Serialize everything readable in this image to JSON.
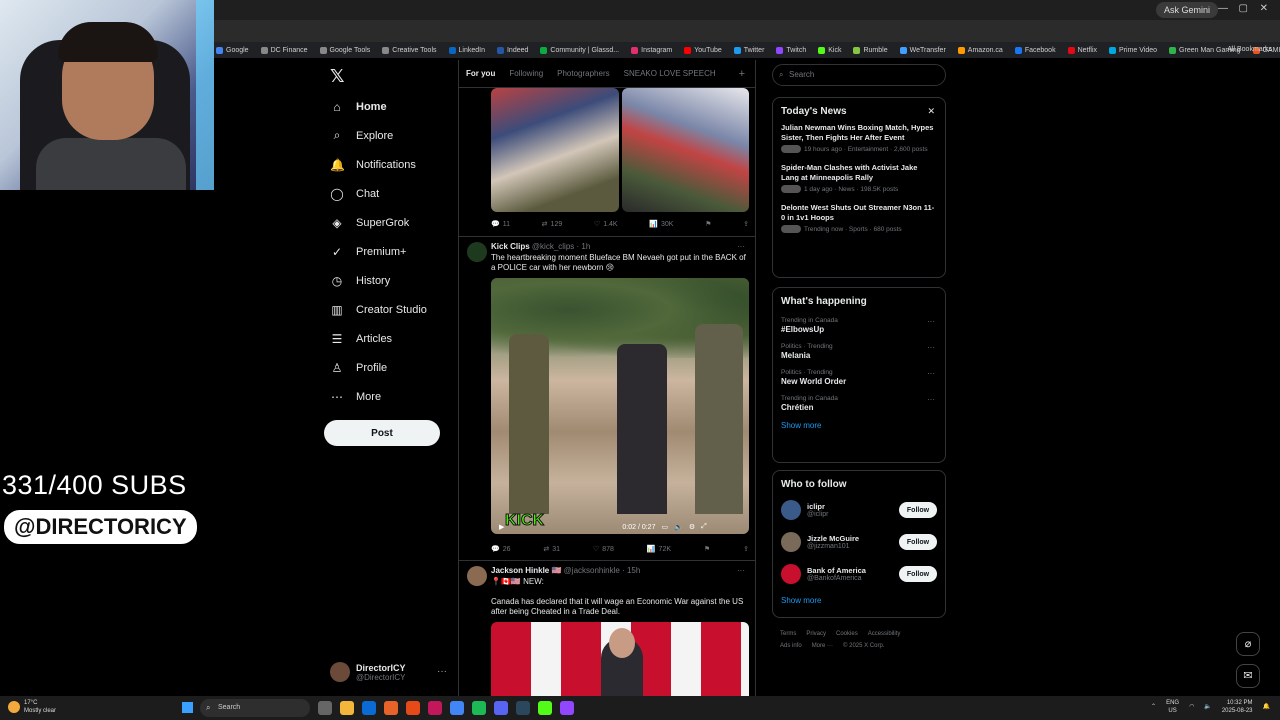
{
  "browser": {
    "gemini_label": "Ask Gemini",
    "bookmarks": [
      {
        "label": "Google",
        "color": "#4285f4"
      },
      {
        "label": "DC Finance",
        "color": "#888888"
      },
      {
        "label": "Google Tools",
        "color": "#888888"
      },
      {
        "label": "Creative Tools",
        "color": "#888888"
      },
      {
        "label": "LinkedIn",
        "color": "#0a66c2"
      },
      {
        "label": "Indeed",
        "color": "#2557a7"
      },
      {
        "label": "Community | Glassd...",
        "color": "#0caa41"
      },
      {
        "label": "Instagram",
        "color": "#e1306c"
      },
      {
        "label": "YouTube",
        "color": "#ff0000"
      },
      {
        "label": "Twitter",
        "color": "#1d9bf0"
      },
      {
        "label": "Twitch",
        "color": "#9146ff"
      },
      {
        "label": "Kick",
        "color": "#53fc18"
      },
      {
        "label": "Rumble",
        "color": "#85c742"
      },
      {
        "label": "WeTransfer",
        "color": "#409fff"
      },
      {
        "label": "Amazon.ca",
        "color": "#ff9900"
      },
      {
        "label": "Facebook",
        "color": "#1877f2"
      },
      {
        "label": "Netflix",
        "color": "#e50914"
      },
      {
        "label": "Prime Video",
        "color": "#00a8e1"
      },
      {
        "label": "Green Man Gaming",
        "color": "#2fb44a"
      },
      {
        "label": "GAMIVO | Video ga...",
        "color": "#e95420"
      }
    ],
    "all_bookmarks": "All Bookmarks"
  },
  "overlay": {
    "subs": "331/400 SUBS",
    "handle": "@DIRECTORICY"
  },
  "nav": {
    "items": [
      {
        "label": "Home",
        "icon": "⌂"
      },
      {
        "label": "Explore",
        "icon": "⌕"
      },
      {
        "label": "Notifications",
        "icon": "🔔"
      },
      {
        "label": "Chat",
        "icon": "◯"
      },
      {
        "label": "SuperGrok",
        "icon": "◈"
      },
      {
        "label": "Premium+",
        "icon": "✓"
      },
      {
        "label": "History",
        "icon": "◷"
      },
      {
        "label": "Creator Studio",
        "icon": "▥"
      },
      {
        "label": "Articles",
        "icon": "☰"
      },
      {
        "label": "Profile",
        "icon": "♙"
      },
      {
        "label": "More",
        "icon": "⋯"
      }
    ],
    "post": "Post",
    "account_name": "DirectorICY",
    "account_handle": "@DirectorICY"
  },
  "feed": {
    "tabs": [
      "For you",
      "Following",
      "Photographers",
      "SNEAKO LOVE SPEECH"
    ],
    "tweet0_actions": {
      "replies": "11",
      "reposts": "129",
      "likes": "1.4K",
      "views": "30K"
    },
    "tweet1": {
      "name": "Kick Clips",
      "handle": "@kick_clips",
      "time": "· 1h",
      "text": "The heartbreaking moment Blueface BM Nevaeh got put in the BACK of a POLICE car with her newborn 😢",
      "video_time": "0:02 / 0:27",
      "watermark": "KICK",
      "actions": {
        "replies": "26",
        "reposts": "31",
        "likes": "878",
        "views": "72K"
      }
    },
    "tweet2": {
      "name": "Jackson Hinkle 🇺🇸",
      "handle": "@jacksonhinkle",
      "time": "· 15h",
      "line1": "📍🇨🇦🇺🇸 NEW:",
      "text": "Canada has declared that it will wage an Economic War against the US after being Cheated in a Trade Deal."
    }
  },
  "sidebar": {
    "search_placeholder": "Search",
    "news_title": "Today's News",
    "news": [
      {
        "headline": "Julian Newman Wins Boxing Match, Hypes Sister, Then Fights Her After Event",
        "meta": "19 hours ago · Entertainment · 2,600 posts"
      },
      {
        "headline": "Spider-Man Clashes with Activist Jake Lang at Minneapolis Rally",
        "meta": "1 day ago · News · 198.5K posts"
      },
      {
        "headline": "Delonte West Shuts Out Streamer N3on 11-0 in 1v1 Hoops",
        "meta": "Trending now · Sports · 680 posts"
      }
    ],
    "happening_title": "What's happening",
    "trends": [
      {
        "context": "Trending in Canada",
        "title": "#ElbowsUp"
      },
      {
        "context": "Politics · Trending",
        "title": "Melania"
      },
      {
        "context": "Politics · Trending",
        "title": "New World Order"
      },
      {
        "context": "Trending in Canada",
        "title": "Chrétien"
      }
    ],
    "show_more": "Show more",
    "follow_title": "Who to follow",
    "follow": [
      {
        "name": "iclipr",
        "handle": "@iclipr",
        "color": "#3a5a8a"
      },
      {
        "name": "Jizzle McGuire",
        "handle": "@jizzman101",
        "color": "#7a6a5a"
      },
      {
        "name": "Bank of America",
        "handle": "@BankofAmerica",
        "color": "#c8102e"
      }
    ],
    "follow_btn": "Follow",
    "footer_line1": [
      "Terms",
      "Privacy",
      "Cookies",
      "Accessibility"
    ],
    "footer_line2": [
      "Ads info",
      "More ···",
      "© 2025 X Corp."
    ]
  },
  "taskbar": {
    "temp": "17°C",
    "weather": "Mostly clear",
    "search": "Search",
    "lang": "ENG",
    "region": "US",
    "time": "10:32 PM",
    "date": "2025-08-23"
  }
}
